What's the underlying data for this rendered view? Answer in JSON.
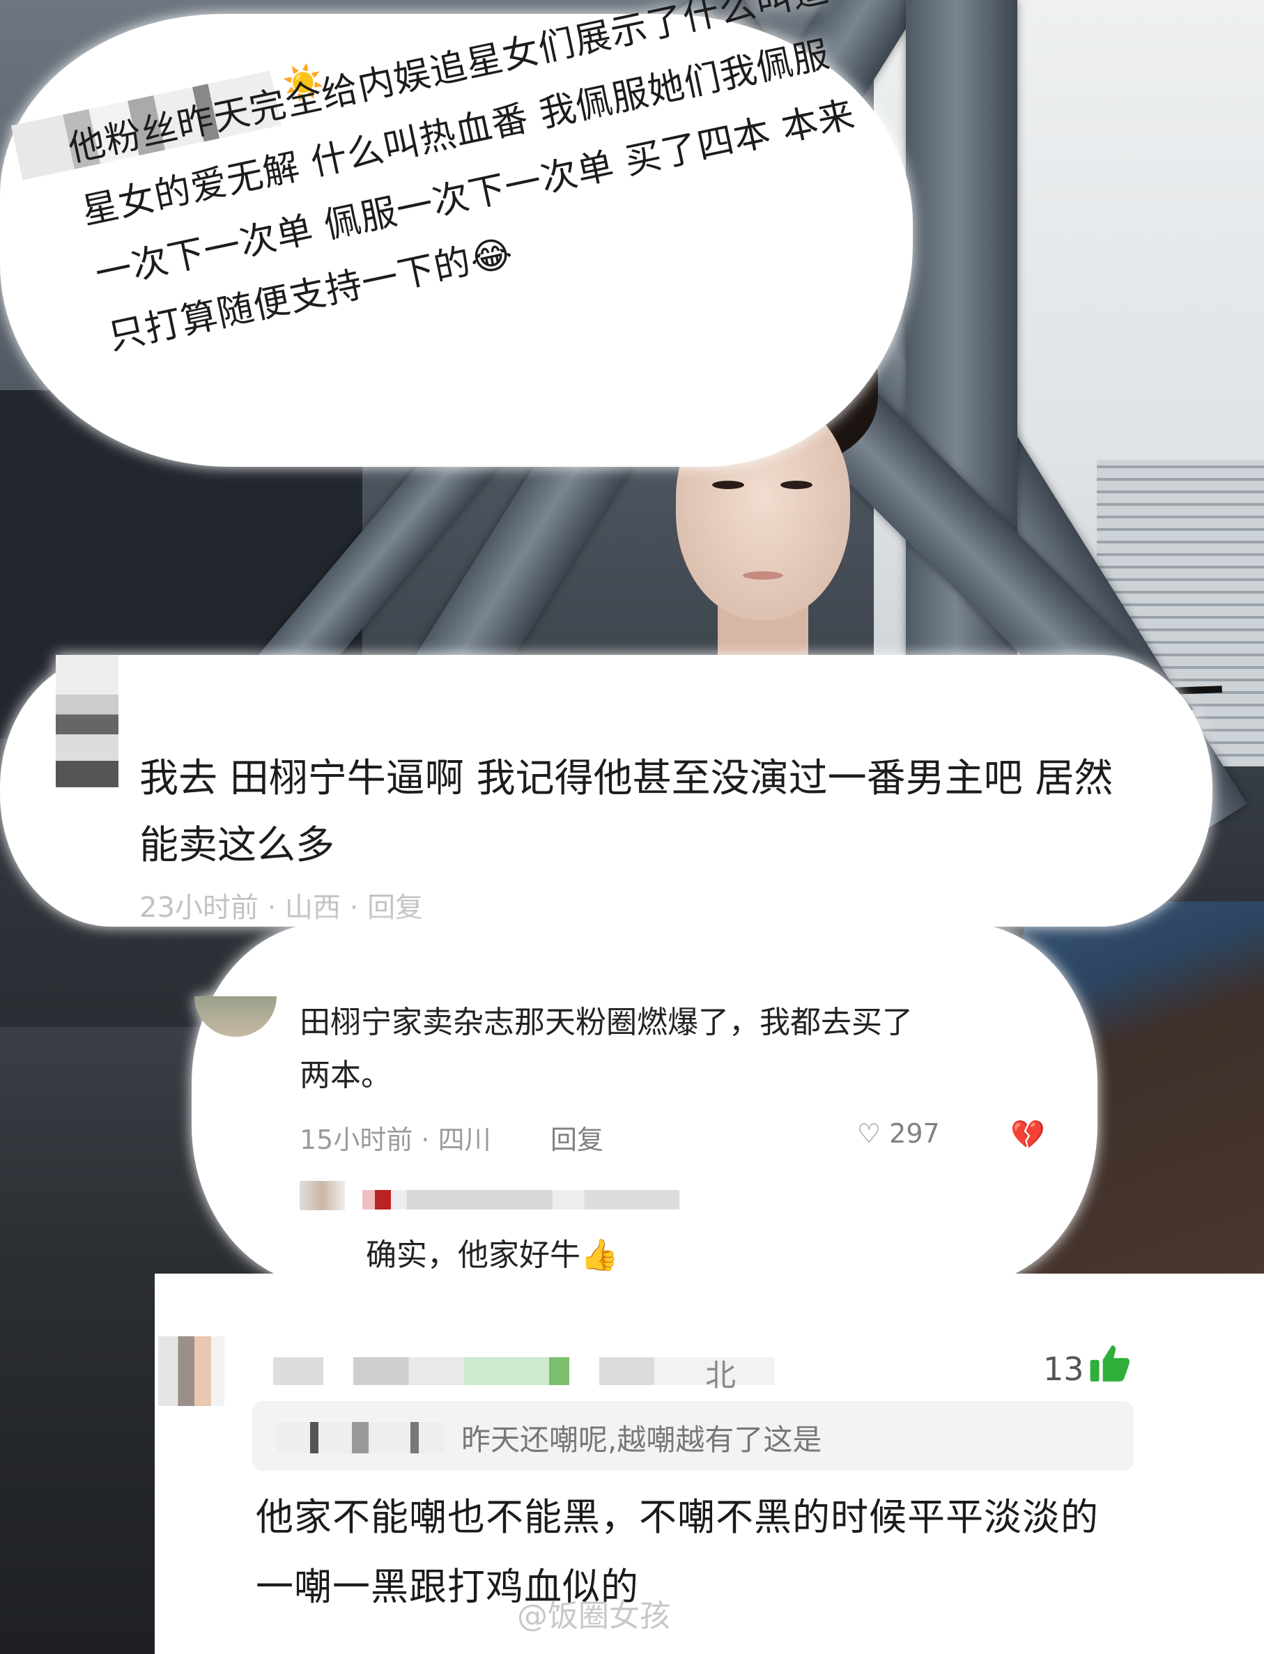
{
  "bubble1": {
    "text": "他粉丝昨天完全给内娱追星女们展示了什么叫追星女的爱无解 什么叫热血番 我佩服她们我佩服一次下一次单 佩服一次下一次单 买了四本 本来只打算随便支持一下的",
    "emoji": "😂"
  },
  "bubble2": {
    "text": "我去 田栩宁牛逼啊 我记得他甚至没演过一番男主吧 居然能卖这么多",
    "meta": "23小时前 · 山西 · 回复"
  },
  "bubble3": {
    "text": "田栩宁家卖杂志那天粉圈燃爆了，我都去买了两本。",
    "time_location": "15小时前 · 四川",
    "reply_label": "回复",
    "like_count": "297",
    "sub_reply": "确实，他家好牛",
    "sub_emoji": "👍"
  },
  "card": {
    "region": "北",
    "like_count": "13",
    "quote_text": "昨天还嘲呢,越嘲越有了这是",
    "body": "他家不能嘲也不能黑，不嘲不黑的时候平平淡淡的 一嘲一黑跟打鸡血似的",
    "watermark": "@饭圈女孩"
  },
  "icons": {
    "sun": "sun-icon",
    "heart": "heart-icon",
    "broken_heart": "broken-heart-icon",
    "thumbs_up": "thumbs-up-icon"
  },
  "colors": {
    "green_like": "#2fae3a",
    "meta_gray": "#9b9b9b"
  }
}
